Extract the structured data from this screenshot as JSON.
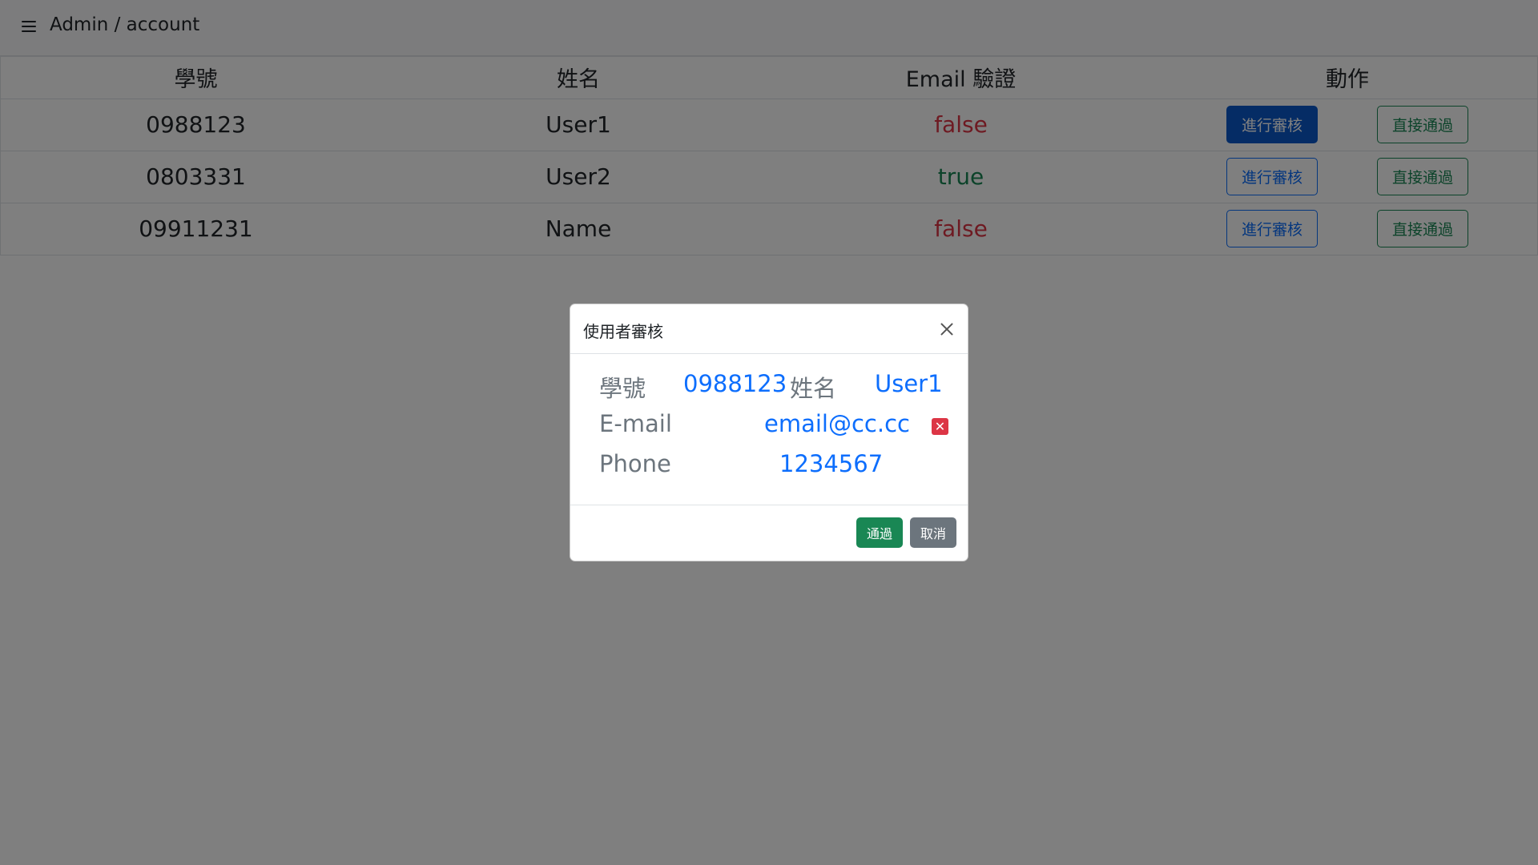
{
  "navbar": {
    "menu_icon": "hamburger-menu-icon",
    "breadcrumb": "Admin / account"
  },
  "table": {
    "headers": [
      "學號",
      "姓名",
      "Email 驗證",
      "動作"
    ],
    "rows": [
      {
        "id": "0988123",
        "name": "User1",
        "email_verified": "false",
        "review_label": "進行審核",
        "approve_label": "直接通過"
      },
      {
        "id": "0803331",
        "name": "User2",
        "email_verified": "true",
        "review_label": "進行審核",
        "approve_label": "直接通過"
      },
      {
        "id": "09911231",
        "name": "Name",
        "email_verified": "false",
        "review_label": "進行審核",
        "approve_label": "直接通過"
      }
    ]
  },
  "modal": {
    "title": "使用者審核",
    "close_icon": "close-icon",
    "id_label": "學號",
    "id_value": "0988123",
    "name_label": "姓名",
    "name_value": "User1",
    "email_label": "E-mail",
    "email_value": "email@cc.cc",
    "email_status_icon": "x-mark-icon",
    "phone_label": "Phone",
    "phone_value": "1234567",
    "approve_label": "通過",
    "cancel_label": "取消"
  },
  "colors": {
    "primary": "#0d6efd",
    "success": "#198754",
    "danger": "#dc3545",
    "secondary": "#6c757d"
  }
}
